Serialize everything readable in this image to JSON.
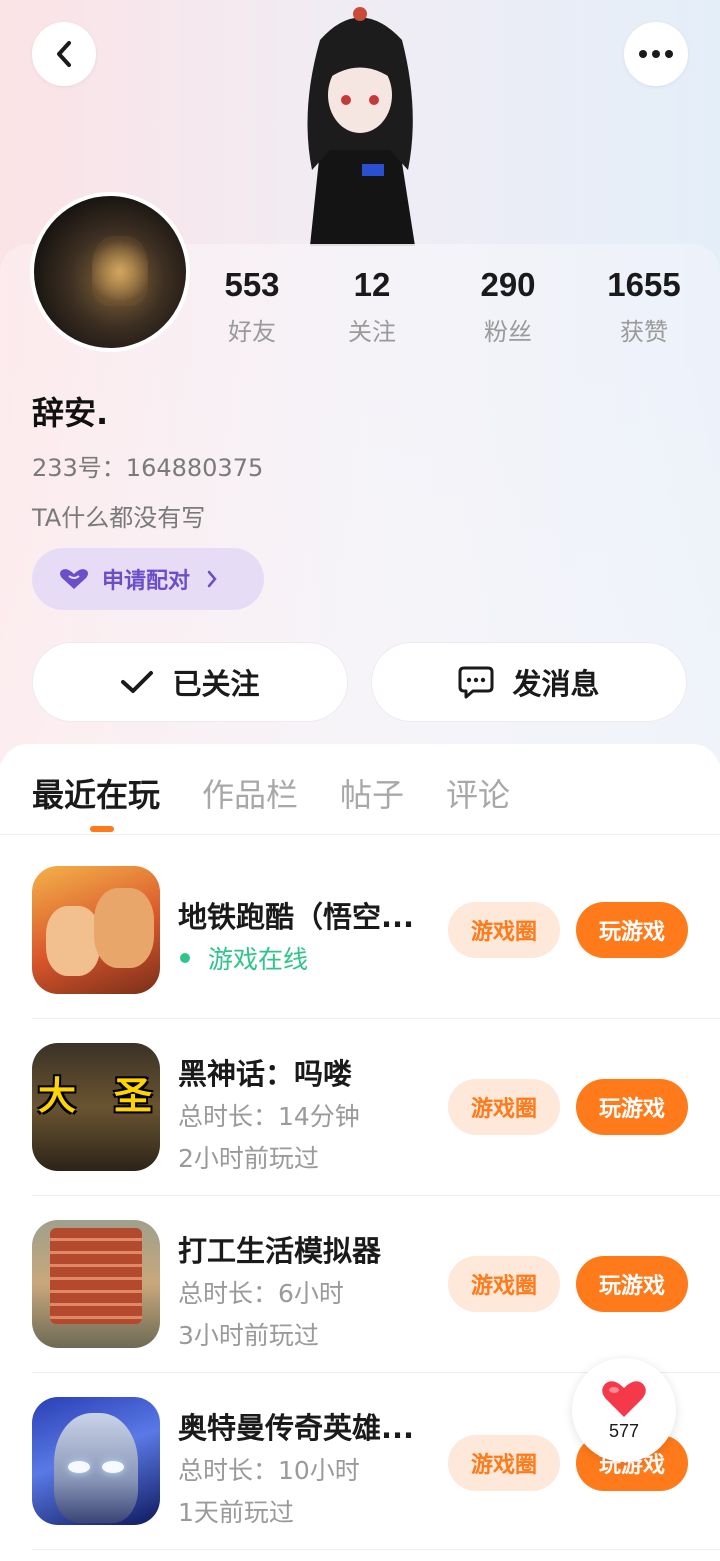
{
  "header": {
    "back_icon": "chevron-left-icon",
    "more_icon": "more-dots-icon"
  },
  "profile": {
    "stats": [
      {
        "value": "553",
        "label": "好友"
      },
      {
        "value": "12",
        "label": "关注"
      },
      {
        "value": "290",
        "label": "粉丝"
      },
      {
        "value": "1655",
        "label": "获赞"
      }
    ],
    "name": "辞安.",
    "uid": "233号：164880375",
    "bio": "TA什么都没有写",
    "pair_button": "申请配对",
    "follow_button": "已关注",
    "message_button": "发消息"
  },
  "tabs": [
    "最近在玩",
    "作品栏",
    "帖子",
    "评论"
  ],
  "active_tab": "最近在玩",
  "games": [
    {
      "title": "地铁跑酷（悟空...",
      "status": "游戏在线",
      "circle": "游戏圈",
      "play": "玩游戏"
    },
    {
      "title": "黑神话：吗喽",
      "duration": "总时长：14分钟",
      "last_played": "2小时前玩过",
      "icon_text_left": "大",
      "icon_text_right": "圣",
      "circle": "游戏圈",
      "play": "玩游戏"
    },
    {
      "title": "打工生活模拟器",
      "duration": "总时长：6小时",
      "last_played": "3小时前玩过",
      "circle": "游戏圈",
      "play": "玩游戏"
    },
    {
      "title": "奥特曼传奇英雄...",
      "duration": "总时长：10小时",
      "last_played": "1天前玩过",
      "circle": "游戏圈",
      "play": "玩游戏"
    }
  ],
  "like_fab": {
    "count": "577"
  },
  "colors": {
    "accent": "#ff7a1a",
    "online": "#2fc58a",
    "pair": "#6a4fc8"
  }
}
